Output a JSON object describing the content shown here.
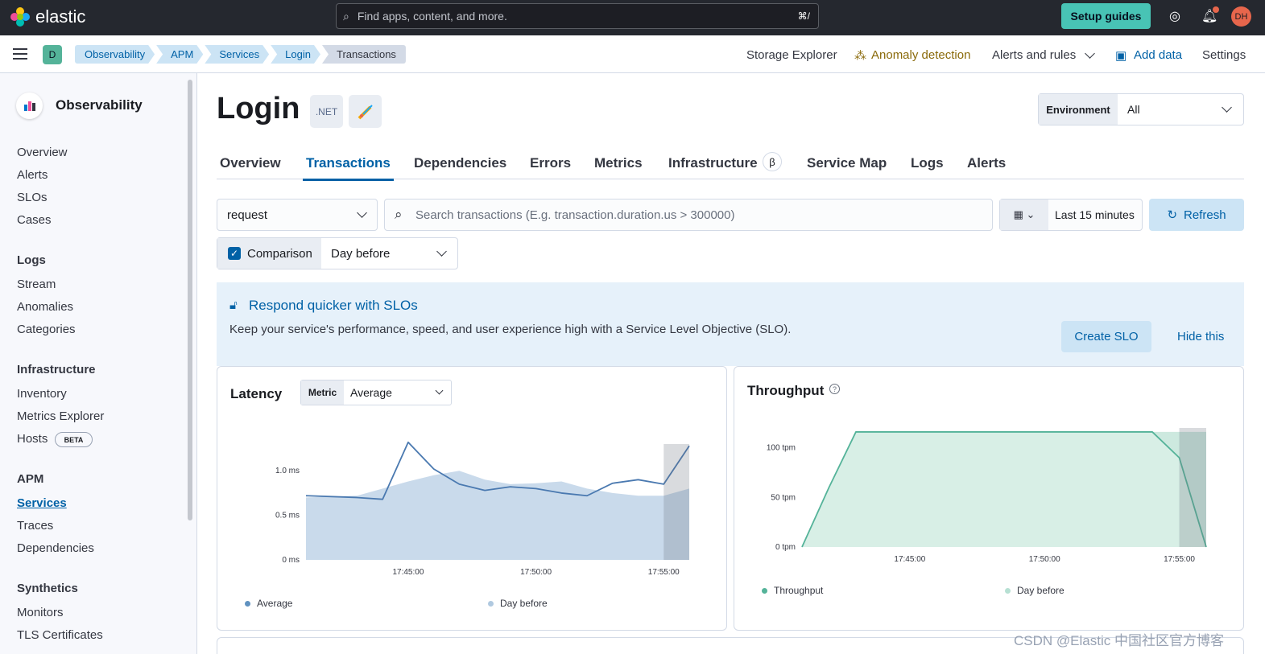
{
  "top": {
    "brand": "elastic",
    "search_placeholder": "Find apps, content, and more.",
    "search_shortcut": "⌘/",
    "setup_label": "Setup guides",
    "avatar": "DH"
  },
  "sub": {
    "space_badge": "D",
    "breadcrumbs": [
      "Observability",
      "APM",
      "Services",
      "Login",
      "Transactions"
    ],
    "nav": {
      "storage": "Storage Explorer",
      "anomaly": "Anomaly detection",
      "alerts": "Alerts and rules",
      "add": "Add data",
      "settings": "Settings"
    }
  },
  "sidebar": {
    "title": "Observability",
    "top_items": [
      "Overview",
      "Alerts",
      "SLOs",
      "Cases"
    ],
    "logs": {
      "head": "Logs",
      "items": [
        "Stream",
        "Anomalies",
        "Categories"
      ]
    },
    "infra": {
      "head": "Infrastructure",
      "items": [
        "Inventory",
        "Metrics Explorer",
        "Hosts"
      ],
      "beta": "BETA"
    },
    "apm": {
      "head": "APM",
      "items": [
        "Services",
        "Traces",
        "Dependencies"
      ]
    },
    "synth": {
      "head": "Synthetics",
      "items": [
        "Monitors",
        "TLS Certificates"
      ]
    }
  },
  "page": {
    "title": "Login",
    "net_badge": ".NET",
    "environment": {
      "label": "Environment",
      "value": "All"
    },
    "tabs": [
      "Overview",
      "Transactions",
      "Dependencies",
      "Errors",
      "Metrics",
      "Infrastructure",
      "Service Map",
      "Logs",
      "Alerts"
    ],
    "beta_symbol": "β",
    "type_select": "request",
    "search_placeholder": "Search transactions (E.g. transaction.duration.us > 300000)",
    "time_range": "Last 15 minutes",
    "refresh": "Refresh",
    "comparison": {
      "label": "Comparison",
      "value": "Day before"
    }
  },
  "callout": {
    "title": "Respond quicker with SLOs",
    "text": "Keep your service's performance, speed, and user experience high with a Service Level Objective (SLO).",
    "create": "Create SLO",
    "hide": "Hide this"
  },
  "latency": {
    "title": "Latency",
    "metric_label": "Metric",
    "metric_value": "Average",
    "legend": [
      "Average",
      "Day before"
    ]
  },
  "throughput": {
    "title": "Throughput",
    "legend": [
      "Throughput",
      "Day before"
    ]
  },
  "watermark": "CSDN @Elastic 中国社区官方博客",
  "colors": {
    "accent": "#0061a6",
    "series_blue": "#6092c0",
    "series_green": "#54b399"
  },
  "chart_data": [
    {
      "type": "line",
      "title": "Latency",
      "x_ticks": [
        "17:45:00",
        "17:50:00",
        "17:55:00"
      ],
      "y_ticks": [
        "0 ms",
        "0.5 ms",
        "1.0 ms"
      ],
      "ylim": [
        0,
        1.3
      ],
      "series": [
        {
          "name": "Average",
          "x": [
            "17:41",
            "17:43",
            "17:44",
            "17:45",
            "17:46",
            "17:47",
            "17:48",
            "17:49",
            "17:50",
            "17:51",
            "17:52",
            "17:53",
            "17:54",
            "17:55",
            "17:56"
          ],
          "values": [
            0.72,
            0.7,
            0.68,
            1.32,
            1.02,
            0.85,
            0.78,
            0.82,
            0.8,
            0.75,
            0.72,
            0.86,
            0.9,
            0.85,
            1.28
          ]
        },
        {
          "name": "Day before",
          "x": [
            "17:41",
            "17:43",
            "17:44",
            "17:45",
            "17:46",
            "17:47",
            "17:48",
            "17:49",
            "17:50",
            "17:51",
            "17:52",
            "17:53",
            "17:54",
            "17:55",
            "17:56"
          ],
          "values": [
            0.7,
            0.72,
            0.8,
            0.88,
            0.95,
            1.0,
            0.9,
            0.85,
            0.86,
            0.88,
            0.8,
            0.75,
            0.72,
            0.72,
            0.8
          ]
        }
      ]
    },
    {
      "type": "area",
      "title": "Throughput",
      "x_ticks": [
        "17:45:00",
        "17:50:00",
        "17:55:00"
      ],
      "y_ticks": [
        "0 tpm",
        "50 tpm",
        "100 tpm"
      ],
      "ylim": [
        0,
        120
      ],
      "series": [
        {
          "name": "Throughput",
          "x": [
            "17:41",
            "17:42",
            "17:43",
            "17:44",
            "17:45",
            "17:50",
            "17:54",
            "17:55",
            "17:56"
          ],
          "values": [
            0,
            60,
            116,
            116,
            116,
            116,
            116,
            90,
            0
          ]
        },
        {
          "name": "Day before",
          "x": [
            "17:41",
            "17:42",
            "17:43",
            "17:44",
            "17:45",
            "17:50",
            "17:54",
            "17:55",
            "17:56"
          ],
          "values": [
            0,
            60,
            116,
            116,
            116,
            116,
            116,
            116,
            116
          ]
        }
      ]
    }
  ]
}
